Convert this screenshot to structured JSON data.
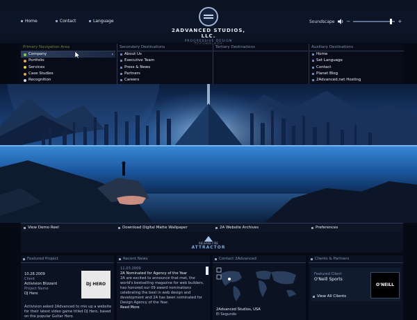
{
  "top_nav": [
    {
      "label": "Home"
    },
    {
      "label": "Contact"
    },
    {
      "label": "Language"
    }
  ],
  "logo": {
    "name": "2ADVANCED STUDIOS, LLC.",
    "tagline": "PROGRESSIVE DESIGN TECHNOLOGY"
  },
  "sound": {
    "label": "Soundscape",
    "level": 0.92
  },
  "menu": {
    "primary": {
      "heading": "Primary Navigation Area",
      "items": [
        "Company",
        "Portfolio",
        "Services",
        "Case Studies",
        "Recognition"
      ]
    },
    "secondary": {
      "heading": "Secondary Destinations",
      "items": [
        "About Us",
        "Executive Team",
        "Press & News",
        "Partners",
        "Careers"
      ]
    },
    "tertiary": {
      "heading": "Tertiary Destinations"
    },
    "auxiliary": {
      "heading": "Auxiliary Destinations",
      "items": [
        "Home",
        "Set Language",
        "Contact",
        "Planet Blog",
        "2Advanced.net Hosting"
      ]
    }
  },
  "strip": [
    {
      "label": "View Demo Reel"
    },
    {
      "label": "Download Digital Matte Wallpaper"
    },
    {
      "label": "2A Website Archives"
    },
    {
      "label": "Preferences"
    }
  ],
  "attractor": {
    "top": "RELEASE FIRE",
    "name": "ATTRACTOR"
  },
  "featured_project": {
    "heading": "Featured Project",
    "date": "10.28.2009",
    "client_label": "Client",
    "client": "Activision Blizzard",
    "project_label": "Project Name",
    "project": "DJ Hero",
    "thumb": "DJ HERO",
    "body": "Activision asked 2Advanced to mix up a website for their latest video game titled DJ Hero, based on the popular Guitar Hero"
  },
  "recent_news": {
    "heading": "Recent News",
    "date": "11.03.2009",
    "title": "2A Nominated for Agency of the Year",
    "body": "2A are excited to announce that rnet, the world's bestselling magazine for web builders, has honored our 09 award nominations celebrating the best in web design and development and 2A has been nominated for Design Agency of the Year.",
    "more": "Read More"
  },
  "contact": {
    "heading": "Contact 2Advanced",
    "office": "2Advanced Studios, USA",
    "city": "El Segundo"
  },
  "clients": {
    "heading": "Clients & Partners",
    "featured_label": "Featured Client",
    "name": "O'Neill Sports",
    "logo": "O'NEILL",
    "view_all": "View All Clients"
  }
}
